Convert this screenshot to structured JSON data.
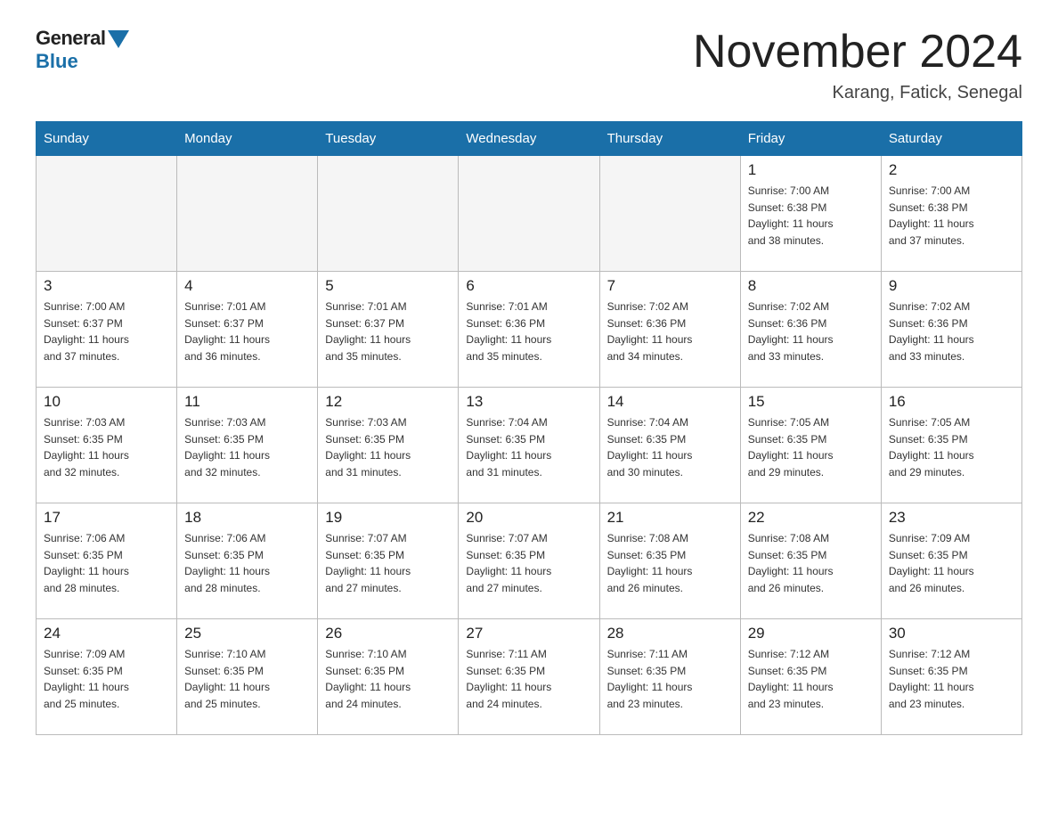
{
  "header": {
    "logo_general": "General",
    "logo_blue": "Blue",
    "title": "November 2024",
    "subtitle": "Karang, Fatick, Senegal"
  },
  "days_of_week": [
    "Sunday",
    "Monday",
    "Tuesday",
    "Wednesday",
    "Thursday",
    "Friday",
    "Saturday"
  ],
  "weeks": [
    [
      {
        "day": "",
        "info": ""
      },
      {
        "day": "",
        "info": ""
      },
      {
        "day": "",
        "info": ""
      },
      {
        "day": "",
        "info": ""
      },
      {
        "day": "",
        "info": ""
      },
      {
        "day": "1",
        "info": "Sunrise: 7:00 AM\nSunset: 6:38 PM\nDaylight: 11 hours\nand 38 minutes."
      },
      {
        "day": "2",
        "info": "Sunrise: 7:00 AM\nSunset: 6:38 PM\nDaylight: 11 hours\nand 37 minutes."
      }
    ],
    [
      {
        "day": "3",
        "info": "Sunrise: 7:00 AM\nSunset: 6:37 PM\nDaylight: 11 hours\nand 37 minutes."
      },
      {
        "day": "4",
        "info": "Sunrise: 7:01 AM\nSunset: 6:37 PM\nDaylight: 11 hours\nand 36 minutes."
      },
      {
        "day": "5",
        "info": "Sunrise: 7:01 AM\nSunset: 6:37 PM\nDaylight: 11 hours\nand 35 minutes."
      },
      {
        "day": "6",
        "info": "Sunrise: 7:01 AM\nSunset: 6:36 PM\nDaylight: 11 hours\nand 35 minutes."
      },
      {
        "day": "7",
        "info": "Sunrise: 7:02 AM\nSunset: 6:36 PM\nDaylight: 11 hours\nand 34 minutes."
      },
      {
        "day": "8",
        "info": "Sunrise: 7:02 AM\nSunset: 6:36 PM\nDaylight: 11 hours\nand 33 minutes."
      },
      {
        "day": "9",
        "info": "Sunrise: 7:02 AM\nSunset: 6:36 PM\nDaylight: 11 hours\nand 33 minutes."
      }
    ],
    [
      {
        "day": "10",
        "info": "Sunrise: 7:03 AM\nSunset: 6:35 PM\nDaylight: 11 hours\nand 32 minutes."
      },
      {
        "day": "11",
        "info": "Sunrise: 7:03 AM\nSunset: 6:35 PM\nDaylight: 11 hours\nand 32 minutes."
      },
      {
        "day": "12",
        "info": "Sunrise: 7:03 AM\nSunset: 6:35 PM\nDaylight: 11 hours\nand 31 minutes."
      },
      {
        "day": "13",
        "info": "Sunrise: 7:04 AM\nSunset: 6:35 PM\nDaylight: 11 hours\nand 31 minutes."
      },
      {
        "day": "14",
        "info": "Sunrise: 7:04 AM\nSunset: 6:35 PM\nDaylight: 11 hours\nand 30 minutes."
      },
      {
        "day": "15",
        "info": "Sunrise: 7:05 AM\nSunset: 6:35 PM\nDaylight: 11 hours\nand 29 minutes."
      },
      {
        "day": "16",
        "info": "Sunrise: 7:05 AM\nSunset: 6:35 PM\nDaylight: 11 hours\nand 29 minutes."
      }
    ],
    [
      {
        "day": "17",
        "info": "Sunrise: 7:06 AM\nSunset: 6:35 PM\nDaylight: 11 hours\nand 28 minutes."
      },
      {
        "day": "18",
        "info": "Sunrise: 7:06 AM\nSunset: 6:35 PM\nDaylight: 11 hours\nand 28 minutes."
      },
      {
        "day": "19",
        "info": "Sunrise: 7:07 AM\nSunset: 6:35 PM\nDaylight: 11 hours\nand 27 minutes."
      },
      {
        "day": "20",
        "info": "Sunrise: 7:07 AM\nSunset: 6:35 PM\nDaylight: 11 hours\nand 27 minutes."
      },
      {
        "day": "21",
        "info": "Sunrise: 7:08 AM\nSunset: 6:35 PM\nDaylight: 11 hours\nand 26 minutes."
      },
      {
        "day": "22",
        "info": "Sunrise: 7:08 AM\nSunset: 6:35 PM\nDaylight: 11 hours\nand 26 minutes."
      },
      {
        "day": "23",
        "info": "Sunrise: 7:09 AM\nSunset: 6:35 PM\nDaylight: 11 hours\nand 26 minutes."
      }
    ],
    [
      {
        "day": "24",
        "info": "Sunrise: 7:09 AM\nSunset: 6:35 PM\nDaylight: 11 hours\nand 25 minutes."
      },
      {
        "day": "25",
        "info": "Sunrise: 7:10 AM\nSunset: 6:35 PM\nDaylight: 11 hours\nand 25 minutes."
      },
      {
        "day": "26",
        "info": "Sunrise: 7:10 AM\nSunset: 6:35 PM\nDaylight: 11 hours\nand 24 minutes."
      },
      {
        "day": "27",
        "info": "Sunrise: 7:11 AM\nSunset: 6:35 PM\nDaylight: 11 hours\nand 24 minutes."
      },
      {
        "day": "28",
        "info": "Sunrise: 7:11 AM\nSunset: 6:35 PM\nDaylight: 11 hours\nand 23 minutes."
      },
      {
        "day": "29",
        "info": "Sunrise: 7:12 AM\nSunset: 6:35 PM\nDaylight: 11 hours\nand 23 minutes."
      },
      {
        "day": "30",
        "info": "Sunrise: 7:12 AM\nSunset: 6:35 PM\nDaylight: 11 hours\nand 23 minutes."
      }
    ]
  ]
}
